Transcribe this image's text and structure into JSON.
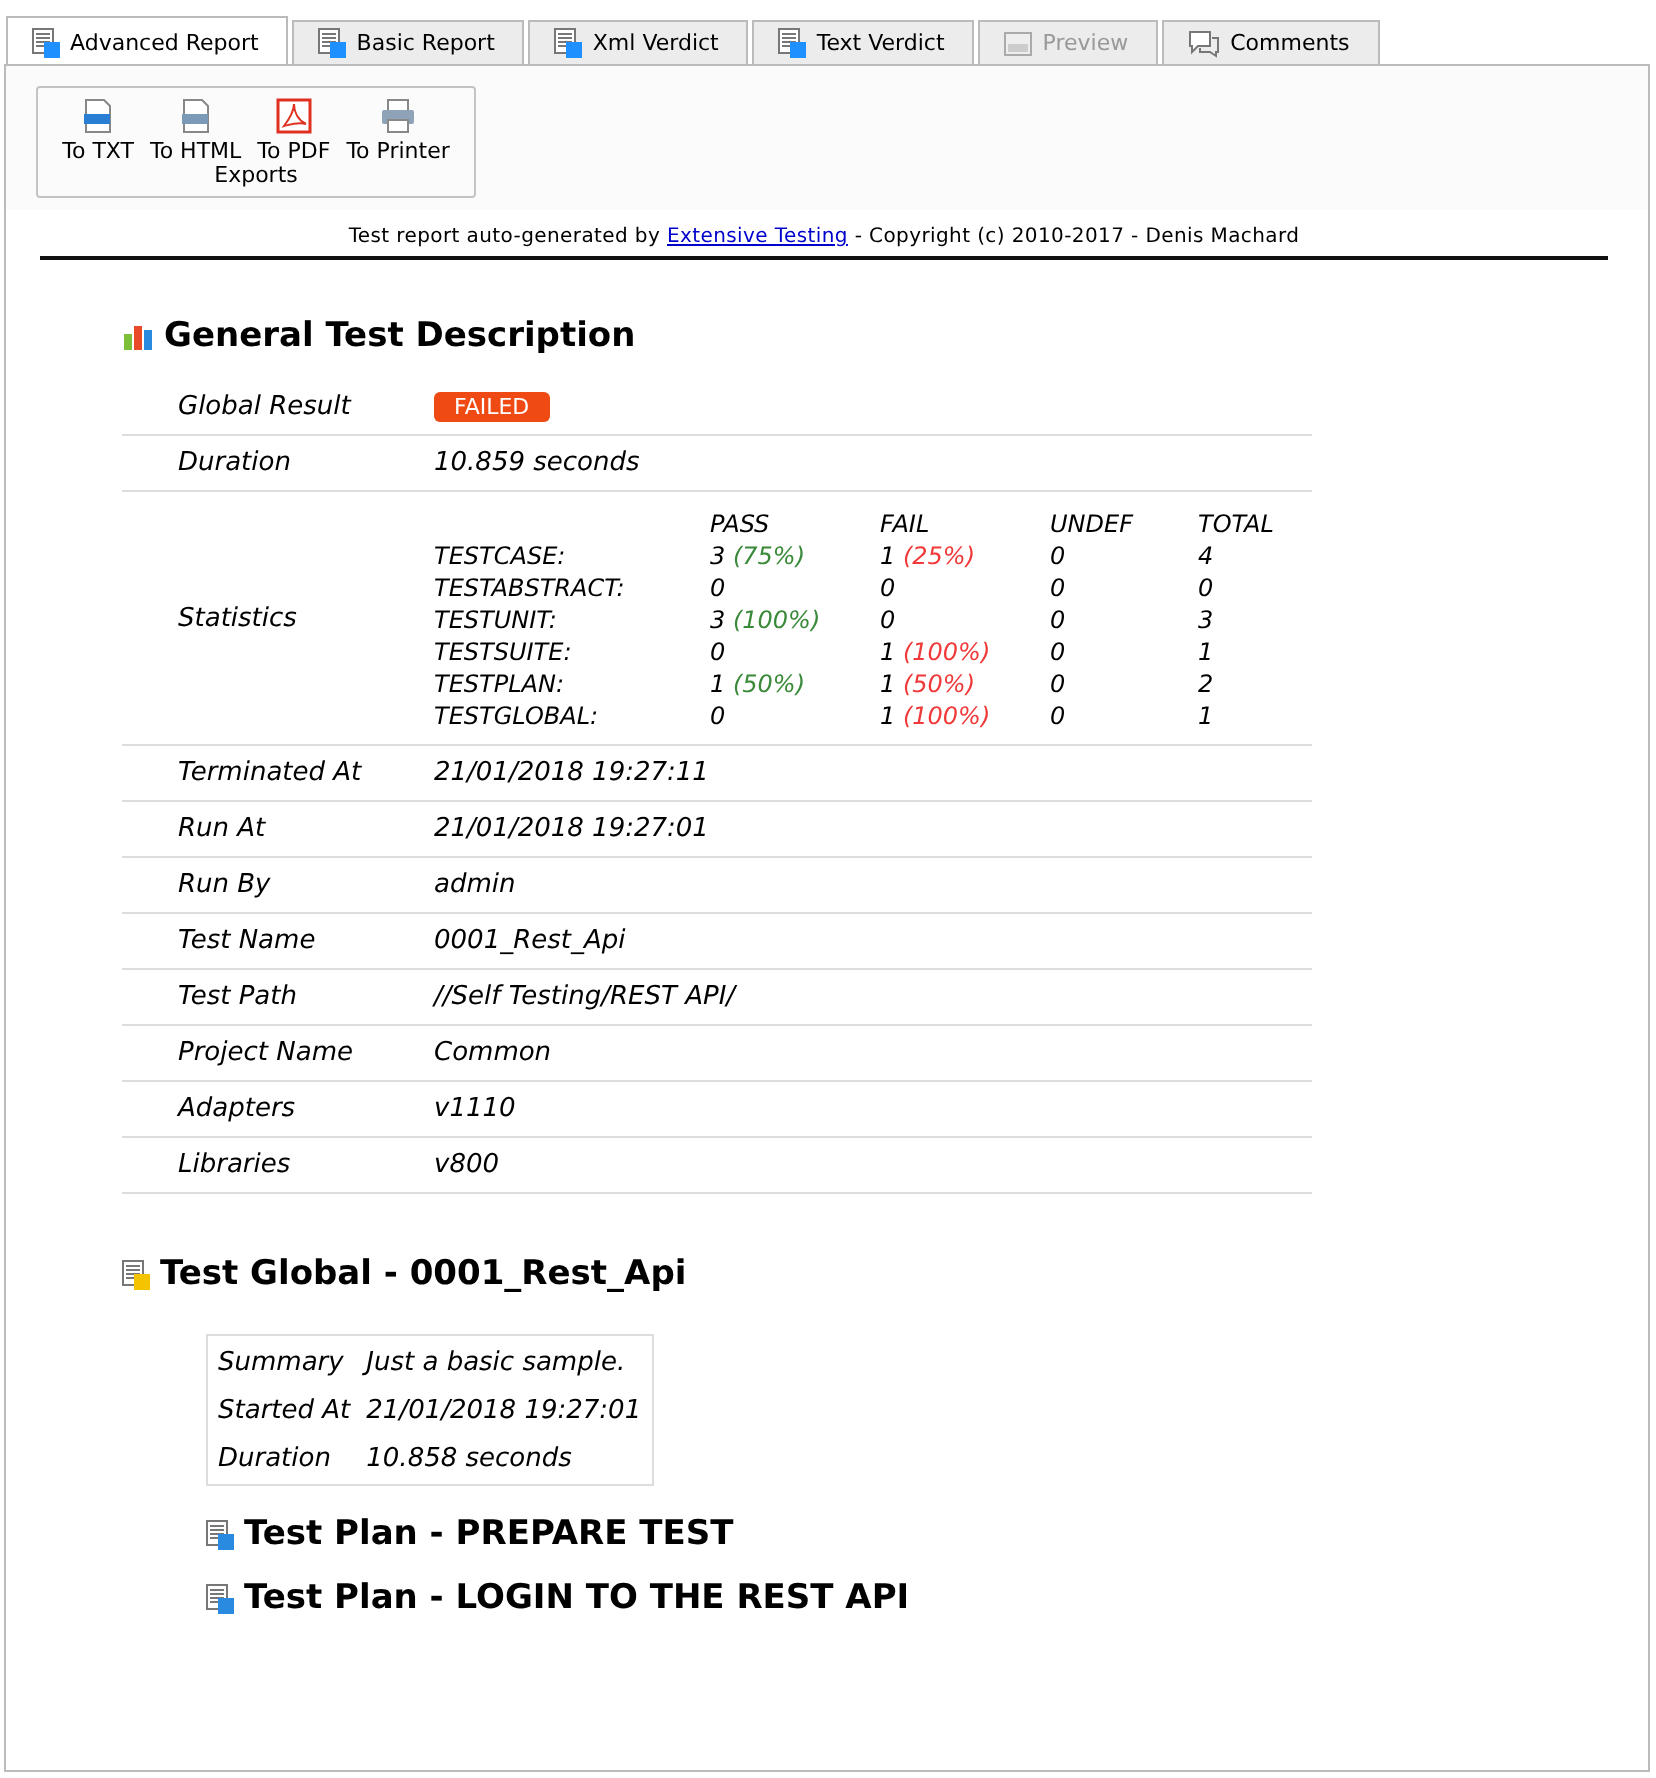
{
  "tabs": [
    {
      "label": "Advanced Report",
      "selected": true,
      "disabled": false
    },
    {
      "label": "Basic Report",
      "selected": false,
      "disabled": false
    },
    {
      "label": "Xml Verdict",
      "selected": false,
      "disabled": false
    },
    {
      "label": "Text Verdict",
      "selected": false,
      "disabled": false
    },
    {
      "label": "Preview",
      "selected": false,
      "disabled": true
    },
    {
      "label": "Comments",
      "selected": false,
      "disabled": false
    }
  ],
  "exports": {
    "title": "Exports",
    "buttons": [
      {
        "label": "To TXT",
        "kind": "txt"
      },
      {
        "label": "To HTML",
        "kind": "html"
      },
      {
        "label": "To PDF",
        "kind": "pdf"
      },
      {
        "label": "To Printer",
        "kind": "printer"
      }
    ]
  },
  "header": {
    "before": "Test report auto-generated by",
    "link": "Extensive Testing",
    "after": "- Copyright (c) 2010-2017 - Denis Machard"
  },
  "general": {
    "title": "General Test Description",
    "global_result": {
      "label": "Global Result",
      "badge": "FAILED"
    },
    "duration": {
      "label": "Duration",
      "value": "10.859 seconds"
    },
    "statistics": {
      "label": "Statistics",
      "columns": [
        {
          "label": "PASS",
          "kind": "pass"
        },
        {
          "label": "FAIL",
          "kind": "fail"
        },
        {
          "label": "UNDEF"
        },
        {
          "label": "TOTAL"
        }
      ],
      "rows": [
        {
          "name": "TESTCASE:",
          "cells": [
            {
              "value": "3",
              "pct": "(75%)"
            },
            {
              "value": "1",
              "pct": "(25%)"
            },
            {
              "value": "0"
            },
            {
              "value": "4"
            }
          ]
        },
        {
          "name": "TESTABSTRACT:",
          "cells": [
            {
              "value": "0"
            },
            {
              "value": "0"
            },
            {
              "value": "0"
            },
            {
              "value": "0"
            }
          ]
        },
        {
          "name": "TESTUNIT:",
          "cells": [
            {
              "value": "3",
              "pct": "(100%)"
            },
            {
              "value": "0"
            },
            {
              "value": "0"
            },
            {
              "value": "3"
            }
          ]
        },
        {
          "name": "TESTSUITE:",
          "cells": [
            {
              "value": "0"
            },
            {
              "value": "1",
              "pct": "(100%)"
            },
            {
              "value": "0"
            },
            {
              "value": "1"
            }
          ]
        },
        {
          "name": "TESTPLAN:",
          "cells": [
            {
              "value": "1",
              "pct": "(50%)"
            },
            {
              "value": "1",
              "pct": "(50%)"
            },
            {
              "value": "0"
            },
            {
              "value": "2"
            }
          ]
        },
        {
          "name": "TESTGLOBAL:",
          "cells": [
            {
              "value": "0"
            },
            {
              "value": "1",
              "pct": "(100%)"
            },
            {
              "value": "0"
            },
            {
              "value": "1"
            }
          ]
        }
      ]
    },
    "fields": [
      {
        "label": "Terminated At",
        "value": "21/01/2018 19:27:11"
      },
      {
        "label": "Run At",
        "value": "21/01/2018 19:27:01"
      },
      {
        "label": "Run By",
        "value": "admin"
      },
      {
        "label": "Test Name",
        "value": "0001_Rest_Api"
      },
      {
        "label": "Test Path",
        "value": "//Self Testing/REST API/"
      },
      {
        "label": "Project Name",
        "value": "Common"
      },
      {
        "label": "Adapters",
        "value": "v1110"
      },
      {
        "label": "Libraries",
        "value": "v800"
      }
    ]
  },
  "test_global": {
    "title": "Test Global - 0001_Rest_Api",
    "summary": [
      {
        "label": "Summary",
        "value": "Just a basic sample."
      },
      {
        "label": "Started At",
        "value": "21/01/2018 19:27:01"
      },
      {
        "label": "Duration",
        "value": "10.858 seconds"
      }
    ],
    "plans": [
      {
        "title": "Test Plan - PREPARE TEST"
      },
      {
        "title": "Test Plan - LOGIN TO THE REST API"
      }
    ]
  }
}
